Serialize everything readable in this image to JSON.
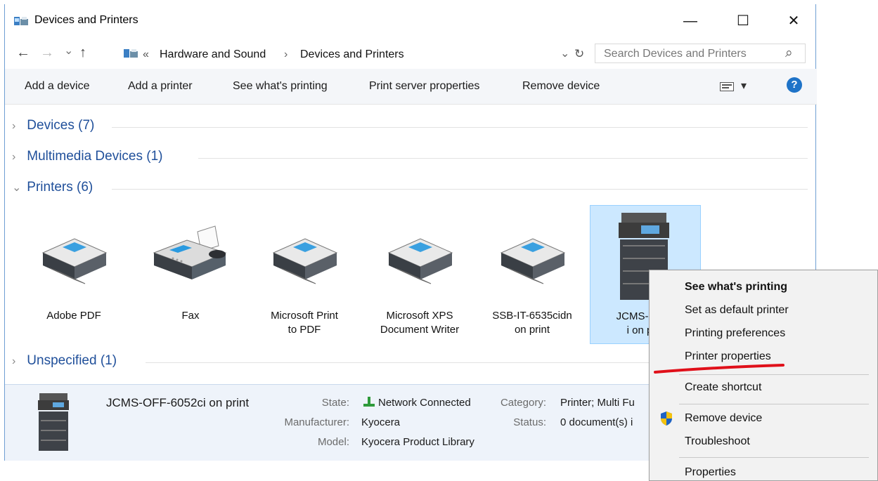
{
  "window": {
    "title": "Devices and Printers",
    "controls": {
      "minimize": "—",
      "maximize": "☐",
      "close": "✕"
    }
  },
  "nav": {
    "back": "←",
    "forward": "→",
    "recent": "⌄",
    "up": "↑",
    "breadcrumb_overflow": "«",
    "breadcrumb": [
      "Hardware and Sound",
      "Devices and Printers"
    ],
    "separator": "›",
    "refresh": "↻",
    "dropdown": "⌄",
    "search_placeholder": "Search Devices and Printers",
    "search_glyph": "⌕"
  },
  "toolbar": {
    "buttons": [
      "Add a device",
      "Add a printer",
      "See what's printing",
      "Print server properties",
      "Remove device"
    ],
    "view_dropdown": "▾",
    "help": "?"
  },
  "groups": {
    "devices": {
      "label": "Devices (7)",
      "chevron": "›"
    },
    "multimedia": {
      "label": "Multimedia Devices (1)",
      "chevron": "›"
    },
    "printers": {
      "label": "Printers (6)",
      "chevron": "⌄"
    },
    "unspecified": {
      "label": "Unspecified (1)",
      "chevron": "›"
    }
  },
  "printers": [
    {
      "label": "Adobe PDF",
      "icon": "printer-icon"
    },
    {
      "label": "Fax",
      "icon": "fax-icon"
    },
    {
      "label": "Microsoft Print\nto PDF",
      "icon": "printer-icon"
    },
    {
      "label": "Microsoft XPS\nDocument Writer",
      "icon": "printer-icon"
    },
    {
      "label": "SSB-IT-6535cidn\non print",
      "icon": "printer-icon"
    },
    {
      "label": "JCMS-OF\ni on p",
      "icon": "copier-icon",
      "selected": true
    }
  ],
  "details": {
    "name": "JCMS-OFF-6052ci on print",
    "state_label": "State:",
    "state_value": "Network Connected",
    "category_label": "Category:",
    "category_value": "Printer; Multi Fu",
    "manufacturer_label": "Manufacturer:",
    "manufacturer_value": "Kyocera",
    "status_label": "Status:",
    "status_value": "0 document(s) i",
    "model_label": "Model:",
    "model_value": "Kyocera Product Library"
  },
  "context_menu": {
    "items": [
      "See what's printing",
      "Set as default printer",
      "Printing preferences",
      "Printer properties",
      "Create shortcut",
      "Remove device",
      "Troubleshoot",
      "Properties"
    ]
  },
  "colors": {
    "accent": "#1e73c8",
    "selection": "#cce8ff",
    "group_heading": "#1f4f9a",
    "annotation": "#e0101a"
  }
}
